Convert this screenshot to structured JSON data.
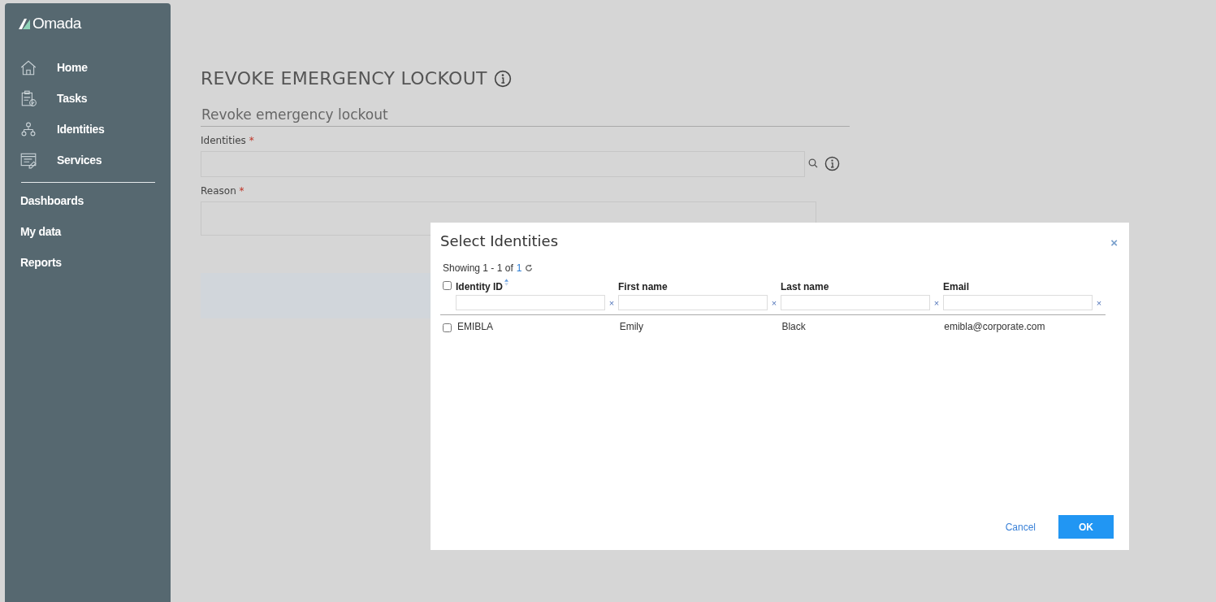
{
  "sidebar": {
    "logo": "Omada",
    "items": [
      {
        "label": "Home"
      },
      {
        "label": "Tasks"
      },
      {
        "label": "Identities"
      },
      {
        "label": "Services"
      }
    ],
    "links": [
      "Dashboards",
      "My data",
      "Reports"
    ]
  },
  "page": {
    "title": "REVOKE EMERGENCY LOCKOUT",
    "section": "Revoke emergency lockout",
    "fields": [
      {
        "label": "Identities",
        "required": true,
        "kind": "lookup"
      },
      {
        "label": "Reason",
        "required": true,
        "kind": "text"
      }
    ],
    "required_mark": "*"
  },
  "dialog": {
    "title": "Select Identities",
    "close": "×",
    "showing": "Showing 1 - 1 of",
    "total": "1",
    "columns": [
      {
        "label": "Identity ID",
        "sorted": true
      },
      {
        "label": "First name",
        "sorted": false
      },
      {
        "label": "Last name",
        "sorted": false
      },
      {
        "label": "Email",
        "sorted": false
      }
    ],
    "clear": "×",
    "select_all_checked": false,
    "rows": [
      {
        "checked": false,
        "cells": [
          "EMIBLA",
          "Emily",
          "Black",
          "emibla@corporate.com"
        ]
      }
    ],
    "buttons": [
      {
        "label": "Cancel",
        "kind": "link"
      },
      {
        "label": "OK",
        "kind": "primary"
      }
    ]
  }
}
